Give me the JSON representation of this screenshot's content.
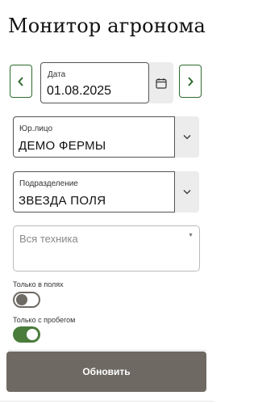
{
  "header": {
    "title": "Монитор агронома"
  },
  "date": {
    "label": "Дата",
    "value": "01.08.2025"
  },
  "company": {
    "label": "Юр.лицо",
    "value": "ДЕМО ФЕРМЫ"
  },
  "division": {
    "label": "Подразделение",
    "value": "ЗВЕЗДА ПОЛЯ"
  },
  "machinery": {
    "placeholder": "Вся техника"
  },
  "filters": {
    "only_in_fields": {
      "label": "Только в полях",
      "enabled": false
    },
    "only_with_mileage": {
      "label": "Только с пробегом",
      "enabled": true
    }
  },
  "actions": {
    "submit_label": "Обновить"
  },
  "colors": {
    "accent": "#4a7c3c",
    "nav_border": "#2f6b2f",
    "button": "#6e6962"
  }
}
